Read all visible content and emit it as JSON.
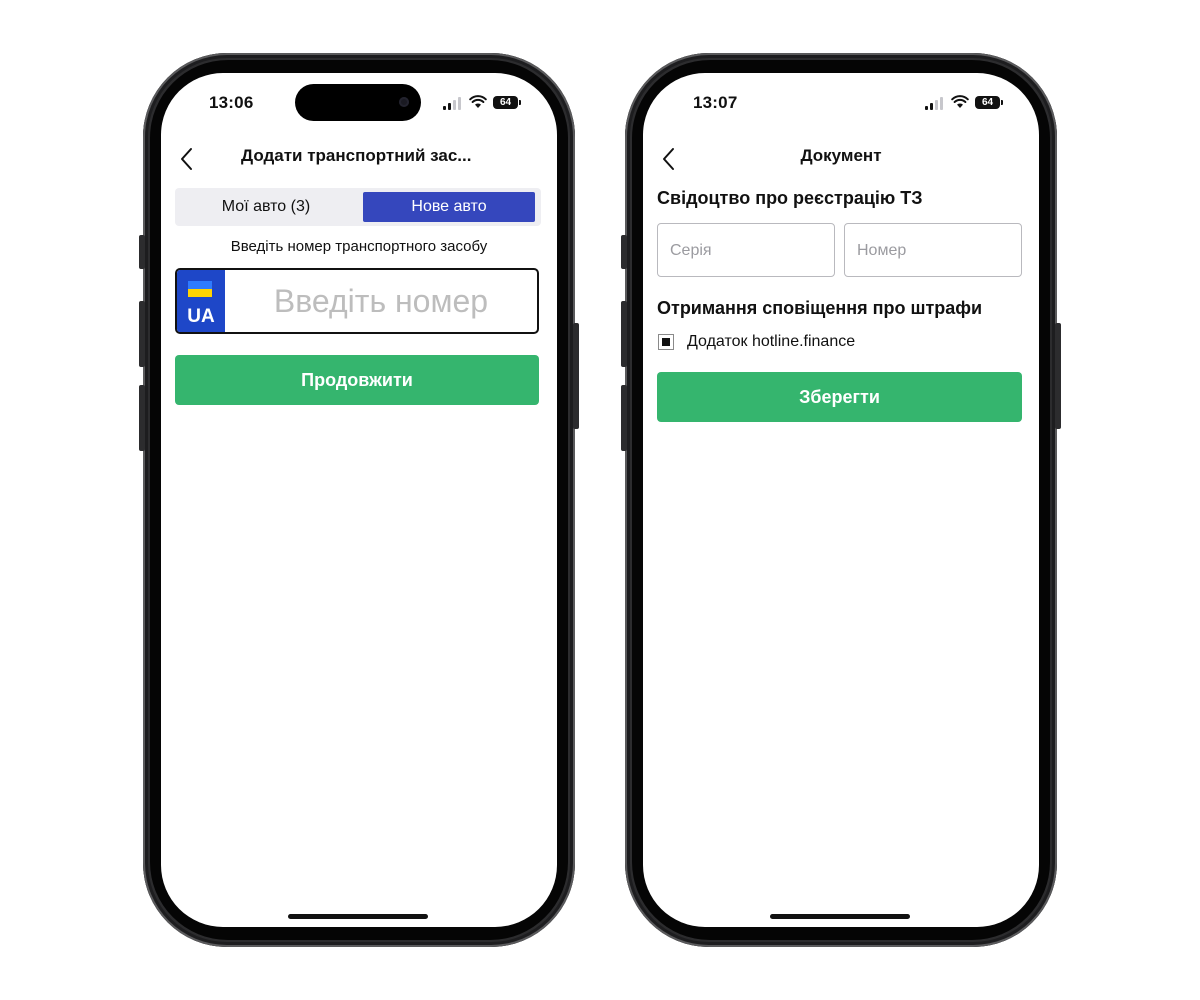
{
  "phone1": {
    "status": {
      "time": "13:06",
      "battery": "64"
    },
    "nav": {
      "title": "Додати транспортний зас..."
    },
    "segmented": {
      "my_cars": "Мої авто (3)",
      "new_car": "Нове авто"
    },
    "hint": "Введіть номер транспортного засобу",
    "plate": {
      "country_code": "UA",
      "placeholder": "Введіть номер"
    },
    "continue_button": "Продовжити"
  },
  "phone2": {
    "status": {
      "time": "13:07",
      "battery": "64"
    },
    "nav": {
      "title": "Документ"
    },
    "registration_title": "Свідоцтво про реєстрацію ТЗ",
    "series_placeholder": "Серія",
    "number_placeholder": "Номер",
    "notifications_title": "Отримання сповіщення про штрафи",
    "checkbox_label": "Додаток hotline.finance",
    "save_button": "Зберегти"
  },
  "colors": {
    "accent_green": "#35b56e",
    "segment_active": "#3547bd",
    "plate_blue": "#1e47c8"
  }
}
